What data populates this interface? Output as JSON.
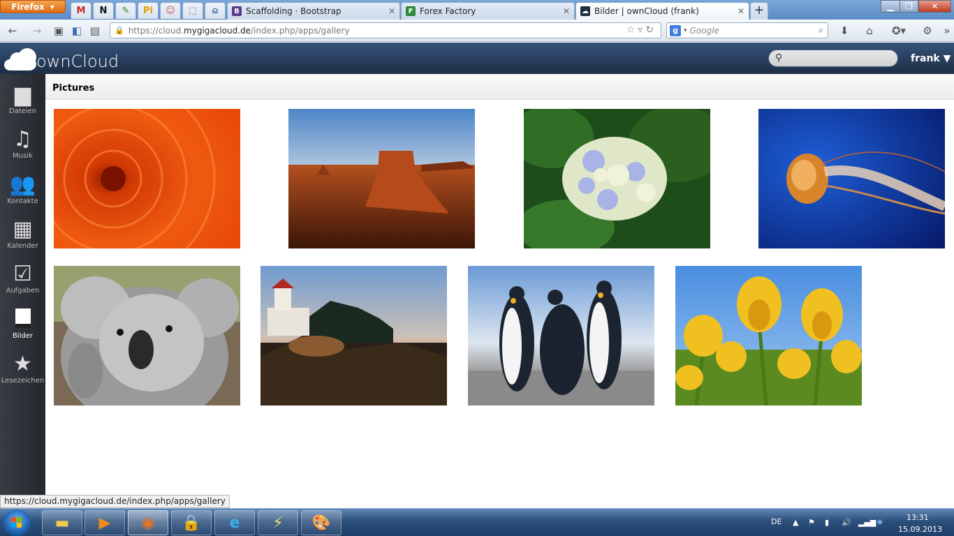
{
  "browser": {
    "menu_label": "Firefox",
    "tabs": [
      {
        "title": "Scaffolding · Bootstrap",
        "favicon": "B",
        "color": "#5b3a8c"
      },
      {
        "title": "Forex Factory",
        "favicon": "F",
        "color": "#2d8a3a"
      },
      {
        "title": "Bilder | ownCloud (frank)",
        "favicon": "☁",
        "color": "#1d2d44"
      }
    ],
    "url": {
      "prefix": "https://cloud.",
      "domain": "mygigacloud.de",
      "path": "/index.php/apps/gallery"
    },
    "search_placeholder": "Google"
  },
  "owncloud": {
    "logo_text": "ownCloud",
    "user": "frank ▼",
    "breadcrumb": "Pictures",
    "nav": [
      {
        "label": "Dateien",
        "icon": "folder-icon"
      },
      {
        "label": "Musik",
        "icon": "music-icon"
      },
      {
        "label": "Kontakte",
        "icon": "contacts-icon"
      },
      {
        "label": "Kalender",
        "icon": "calendar-icon"
      },
      {
        "label": "Aufgaben",
        "icon": "tasks-icon"
      },
      {
        "label": "Bilder",
        "icon": "pictures-icon"
      },
      {
        "label": "Lesezeichen",
        "icon": "bookmark-icon"
      }
    ],
    "active_nav": "Bilder",
    "photos": [
      "Chrysanthemum",
      "Desert",
      "Hydrangeas",
      "Jellyfish",
      "Koala",
      "Lighthouse",
      "Penguins",
      "Tulips"
    ]
  },
  "status_url": "https://cloud.mygigacloud.de/index.php/apps/gallery",
  "taskbar": {
    "language": "DE",
    "time": "13:31",
    "date": "15.09.2013"
  }
}
